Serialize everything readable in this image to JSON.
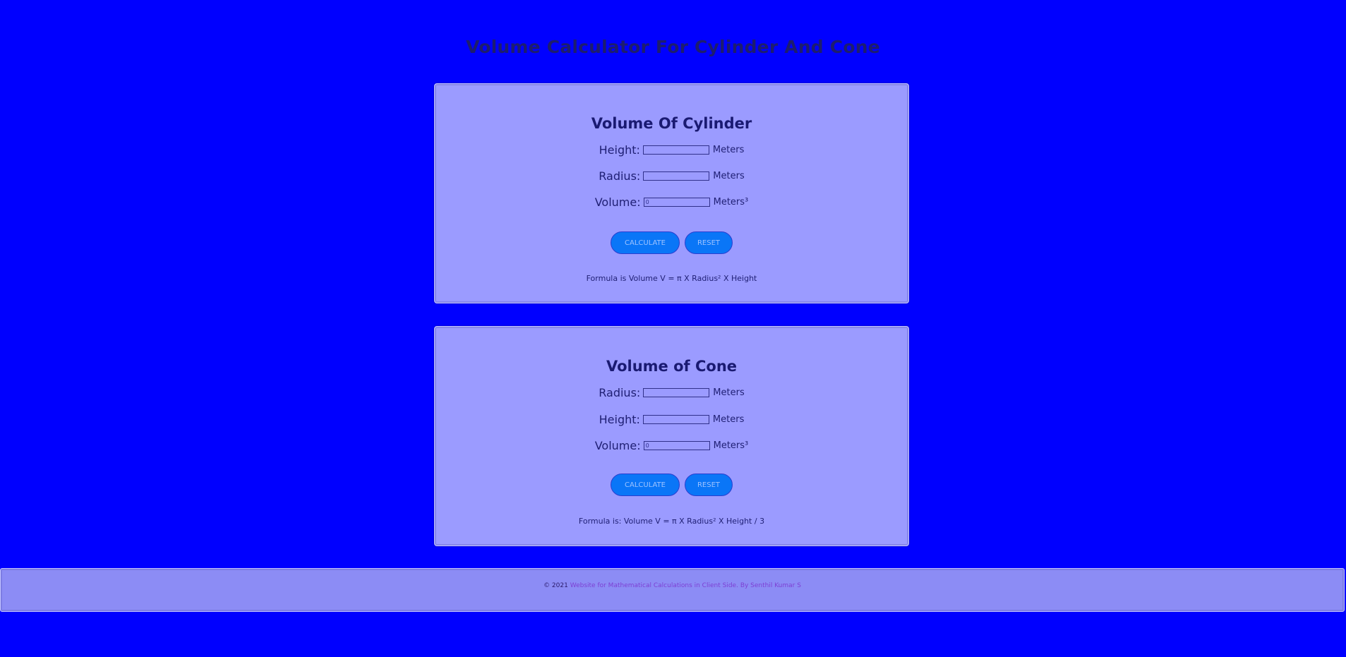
{
  "page": {
    "title": "Volume Calculator For Cylinder And Cone"
  },
  "cylinder": {
    "title": "Volume Of Cylinder",
    "fields": [
      {
        "label": "Height:",
        "value": "",
        "unit": "Meters"
      },
      {
        "label": "Radius:",
        "value": "",
        "unit": "Meters"
      },
      {
        "label": "Volume:",
        "value": "0",
        "unit": "Meters³"
      }
    ],
    "calculate_label": "CALCULATE",
    "reset_label": "RESET",
    "formula": "Formula is Volume V = π X Radius² X Height"
  },
  "cone": {
    "title": "Volume of Cone",
    "fields": [
      {
        "label": "Radius:",
        "value": "",
        "unit": "Meters"
      },
      {
        "label": "Height:",
        "value": "",
        "unit": "Meters"
      },
      {
        "label": "Volume:",
        "value": "0",
        "unit": "Meters³"
      }
    ],
    "calculate_label": "CALCULATE",
    "reset_label": "RESET",
    "formula": "Formula is: Volume V = π X Radius² X Height / 3"
  },
  "footer": {
    "copyright": "© 2021",
    "link_text": "Website for Mathematical Calculations in Client Side.",
    "author": "By Senthil Kumar S"
  },
  "colors": {
    "background": "#0000ff",
    "card": "#9b9bff",
    "button": "#0a76f7",
    "footer": "#8c8cf5",
    "link": "#7d3fd4"
  }
}
